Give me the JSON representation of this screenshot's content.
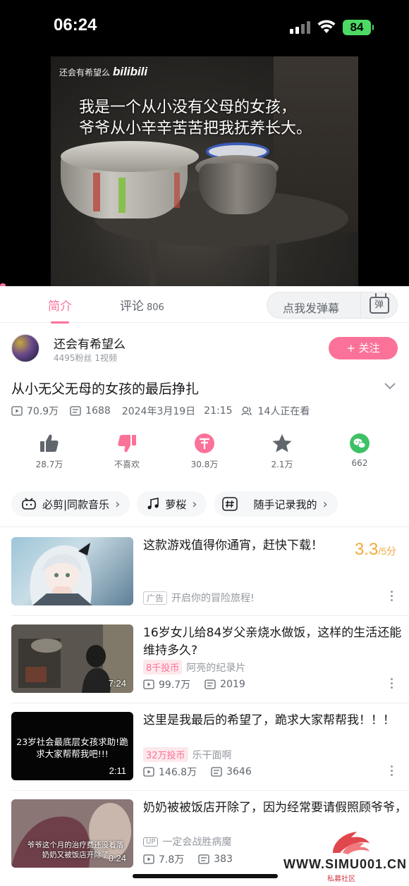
{
  "status_bar": {
    "time": "06:24",
    "battery": "84"
  },
  "video": {
    "watermark_name": "还会有希望么",
    "watermark_logo": "bilibili",
    "subtitle_line1": "我是一个从小没有父母的女孩，",
    "subtitle_line2": "爷爷从小辛辛苦苦把我抚养长大。"
  },
  "tabs": {
    "intro": "简介",
    "comments": "评论",
    "comments_count": "806",
    "danmaku_placeholder": "点我发弹幕",
    "danmaku_button": "弹"
  },
  "uploader": {
    "name": "还会有希望么",
    "stats": "4495粉丝  1视频",
    "follow": "+ 关注"
  },
  "video_info": {
    "title": "从小无父无母的女孩的最后挣扎",
    "views": "70.9万",
    "danmaku": "1688",
    "date": "2024年3月19日",
    "time": "21:15",
    "watching": "14人正在看"
  },
  "actions": [
    {
      "label": "28.7万",
      "icon": "like-icon"
    },
    {
      "label": "不喜欢",
      "icon": "dislike-icon"
    },
    {
      "label": "30.8万",
      "icon": "coin-icon"
    },
    {
      "label": "2.1万",
      "icon": "favorite-icon"
    },
    {
      "label": "662",
      "icon": "wechat-share-icon"
    }
  ],
  "tags": [
    {
      "label": "必剪|同款音乐",
      "icon": "bijian-icon"
    },
    {
      "label": "萝桜",
      "icon": "music-icon"
    },
    {
      "label": "随手记录我的",
      "icon": "hashtag-icon"
    }
  ],
  "recommendations": [
    {
      "title": "这款游戏值得你通宵，赶快下载！",
      "ad_label": "广告",
      "ad_text": "开启你的冒险旅程!",
      "score": "3.3",
      "score_of": "/5分"
    },
    {
      "title": "16岁女儿给84岁父亲烧水做饭，这样的生活还能维持多久?",
      "duration": "7:24",
      "coins": "8千投币",
      "author": "阿亮的纪录片",
      "views": "99.7万",
      "danmaku": "2019"
    },
    {
      "title": "这里是我最后的希望了，跪求大家帮帮我！！！",
      "duration": "2:11",
      "thumb_text": "23岁社会最底层女孩求助!跪求大家帮帮我吧!!!",
      "coins": "32万投币",
      "author": "乐干面啊",
      "views": "146.8万",
      "danmaku": "3646"
    },
    {
      "title": "奶奶被被饭店开除了，因为经常要请假照顾爷爷，",
      "duration": "0:24",
      "thumb_text": "爷爷这个月的治疗费还没着落 奶奶又被饭店开除了",
      "up_label": "UP",
      "author": "一定会战胜病魔",
      "views": "7.8万",
      "danmaku": "383"
    }
  ],
  "watermark": {
    "text": "WWW.SIMU001.CN",
    "sub": "私募社区"
  },
  "colors": {
    "accent": "#fb7299",
    "score": "#f2a93b"
  }
}
